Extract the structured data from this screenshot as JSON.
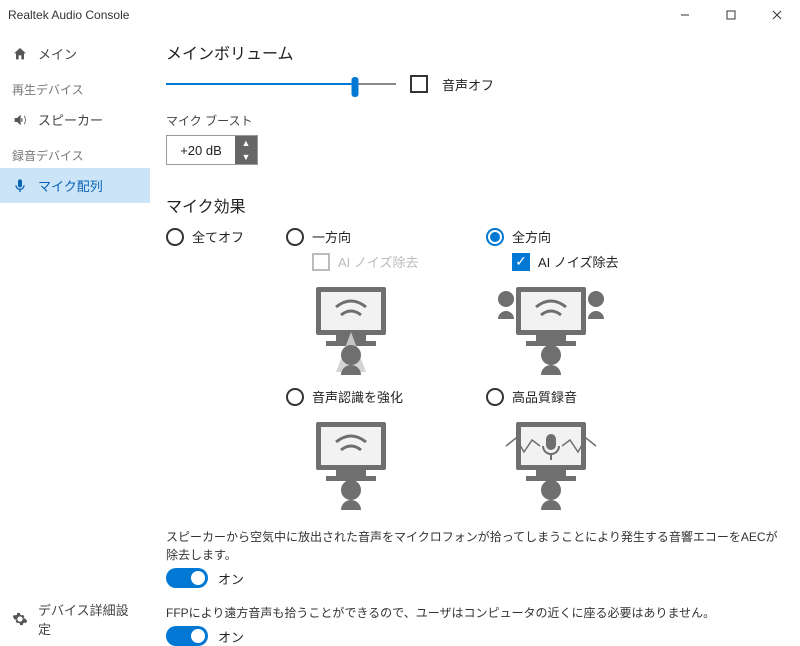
{
  "titlebar": {
    "title": "Realtek Audio Console"
  },
  "sidebar": {
    "main_label": "メイン",
    "playback_section": "再生デバイス",
    "speaker_label": "スピーカー",
    "recording_section": "録音デバイス",
    "mic_array_label": "マイク配列",
    "advanced_label": "デバイス詳細設定"
  },
  "main": {
    "volume_title": "メインボリューム",
    "volume_percent": 82,
    "mute_label": "音声オフ",
    "mute_checked": false,
    "boost_label": "マイク ブースト",
    "boost_value": "+20 dB",
    "effects_title": "マイク効果",
    "options": {
      "all_off": "全てオフ",
      "one_dir": "一方向",
      "omni": "全方向",
      "voice_rec": "音声認識を強化",
      "hq_rec": "高品質録音",
      "ai_nr": "AI ノイズ除去",
      "selected": "omni",
      "ai_nr_omni_checked": true
    },
    "aec_desc": "スピーカーから空気中に放出された音声をマイクロフォンが拾ってしまうことにより発生する音響エコーをAECが除去します。",
    "aec_state": "オン",
    "ffp_desc": "FFPにより遠方音声も拾うことができるので、ユーザはコンピュータの近くに座る必要はありません。",
    "ffp_state": "オン"
  }
}
